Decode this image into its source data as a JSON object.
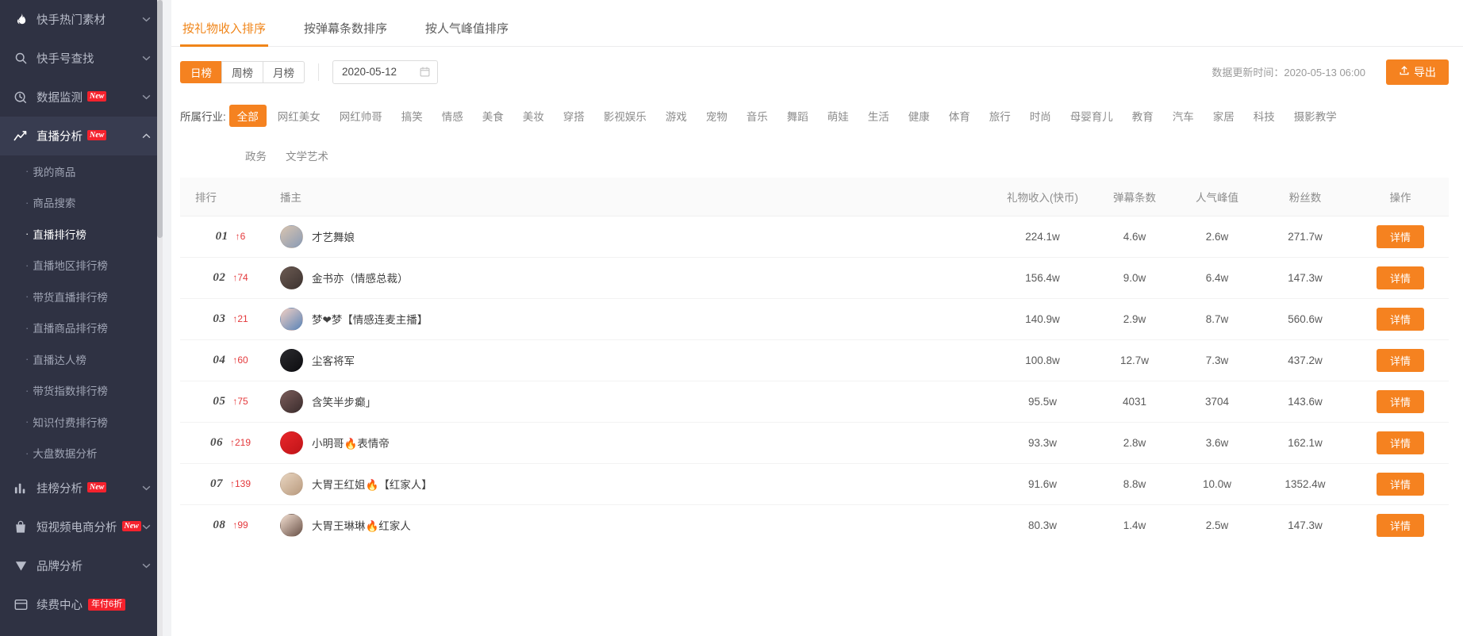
{
  "sidebar": {
    "groups": [
      {
        "id": "hot-material",
        "label": "快手热门素材",
        "icon": "flame-icon",
        "badge": null,
        "expanded": false,
        "active": false
      },
      {
        "id": "account-search",
        "label": "快手号查找",
        "icon": "search-icon",
        "badge": null,
        "expanded": false,
        "active": false
      },
      {
        "id": "data-monitor",
        "label": "数据监测",
        "icon": "monitor-icon",
        "badge": "New",
        "expanded": false,
        "active": false
      },
      {
        "id": "live-analysis",
        "label": "直播分析",
        "icon": "trend-icon",
        "badge": "New",
        "expanded": true,
        "active": true
      }
    ],
    "sub_items": [
      {
        "id": "my-goods",
        "label": "我的商品",
        "current": false
      },
      {
        "id": "goods-search",
        "label": "商品搜索",
        "current": false
      },
      {
        "id": "live-rank",
        "label": "直播排行榜",
        "current": true
      },
      {
        "id": "live-region-rank",
        "label": "直播地区排行榜",
        "current": false
      },
      {
        "id": "goods-live-rank",
        "label": "带货直播排行榜",
        "current": false
      },
      {
        "id": "live-goods-rank",
        "label": "直播商品排行榜",
        "current": false
      },
      {
        "id": "live-talent-rank",
        "label": "直播达人榜",
        "current": false
      },
      {
        "id": "goods-index-rank",
        "label": "带货指数排行榜",
        "current": false
      },
      {
        "id": "knowledge-pay-rank",
        "label": "知识付费排行榜",
        "current": false
      },
      {
        "id": "market-data-analysis",
        "label": "大盘数据分析",
        "current": false
      }
    ],
    "groups_bottom": [
      {
        "id": "board-analysis",
        "label": "挂榜分析",
        "icon": "bars-icon",
        "badge": "New"
      },
      {
        "id": "short-video-ecom",
        "label": "短视频电商分析",
        "icon": "bag-icon",
        "badge": "New"
      },
      {
        "id": "brand-analysis",
        "label": "品牌分析",
        "icon": "shield-icon",
        "badge": null
      },
      {
        "id": "renew-center",
        "label": "续费中心",
        "icon": "card-icon",
        "badge": "年付6折"
      }
    ]
  },
  "tabs": [
    {
      "id": "by-gift-income",
      "label": "按礼物收入排序",
      "selected": true
    },
    {
      "id": "by-danmu-count",
      "label": "按弹幕条数排序",
      "selected": false
    },
    {
      "id": "by-peak-popularity",
      "label": "按人气峰值排序",
      "selected": false
    }
  ],
  "filter": {
    "periods": [
      {
        "id": "daily",
        "label": "日榜",
        "selected": true
      },
      {
        "id": "weekly",
        "label": "周榜",
        "selected": false
      },
      {
        "id": "monthly",
        "label": "月榜",
        "selected": false
      }
    ],
    "date_value": "2020-05-12",
    "updated_text": "数据更新时间：2020-05-13 06:00",
    "export_label": "导出"
  },
  "industry": {
    "label": "所属行业:",
    "chips": [
      {
        "id": "all",
        "label": "全部",
        "selected": true
      },
      {
        "id": "net-beauty",
        "label": "网红美女",
        "selected": false
      },
      {
        "id": "net-handsome",
        "label": "网红帅哥",
        "selected": false
      },
      {
        "id": "funny",
        "label": "搞笑",
        "selected": false
      },
      {
        "id": "emotion",
        "label": "情感",
        "selected": false
      },
      {
        "id": "food",
        "label": "美食",
        "selected": false
      },
      {
        "id": "makeup",
        "label": "美妆",
        "selected": false
      },
      {
        "id": "outfit",
        "label": "穿搭",
        "selected": false
      },
      {
        "id": "film-ent",
        "label": "影视娱乐",
        "selected": false
      },
      {
        "id": "game",
        "label": "游戏",
        "selected": false
      },
      {
        "id": "pet",
        "label": "宠物",
        "selected": false
      },
      {
        "id": "music",
        "label": "音乐",
        "selected": false
      },
      {
        "id": "dance",
        "label": "舞蹈",
        "selected": false
      },
      {
        "id": "cute-baby",
        "label": "萌娃",
        "selected": false
      },
      {
        "id": "life",
        "label": "生活",
        "selected": false
      },
      {
        "id": "health",
        "label": "健康",
        "selected": false
      },
      {
        "id": "sports",
        "label": "体育",
        "selected": false
      },
      {
        "id": "travel",
        "label": "旅行",
        "selected": false
      },
      {
        "id": "fashion",
        "label": "时尚",
        "selected": false
      },
      {
        "id": "parenting",
        "label": "母婴育儿",
        "selected": false
      },
      {
        "id": "education",
        "label": "教育",
        "selected": false
      },
      {
        "id": "auto",
        "label": "汽车",
        "selected": false
      },
      {
        "id": "home",
        "label": "家居",
        "selected": false
      },
      {
        "id": "tech",
        "label": "科技",
        "selected": false
      },
      {
        "id": "photography",
        "label": "摄影教学",
        "selected": false
      },
      {
        "id": "government",
        "label": "政务",
        "selected": false
      },
      {
        "id": "literature-art",
        "label": "文学艺术",
        "selected": false
      }
    ]
  },
  "table": {
    "headers": {
      "rank": "排行",
      "host": "播主",
      "gift_income": "礼物收入(快币)",
      "danmu_count": "弹幕条数",
      "peak_popularity": "人气峰值",
      "fans": "粉丝数",
      "action": "操作"
    },
    "detail_label": "详情",
    "rows": [
      {
        "rank": "01",
        "change": "↑6",
        "name": "才艺舞娘",
        "gift_income": "224.1w",
        "danmu": "4.6w",
        "peak": "2.6w",
        "fans": "271.7w",
        "c1": "#d8c4b0",
        "c2": "#8a9bb5"
      },
      {
        "rank": "02",
        "change": "↑74",
        "name": "金书亦（情感总裁）",
        "gift_income": "156.4w",
        "danmu": "9.0w",
        "peak": "6.4w",
        "fans": "147.3w",
        "c1": "#6b5a52",
        "c2": "#3d3330"
      },
      {
        "rank": "03",
        "change": "↑21",
        "name": "梦❤梦【情感连麦主播】",
        "gift_income": "140.9w",
        "danmu": "2.9w",
        "peak": "8.7w",
        "fans": "560.6w",
        "c1": "#f0cfc4",
        "c2": "#5a84b8"
      },
      {
        "rank": "04",
        "change": "↑60",
        "name": "尘客将军",
        "gift_income": "100.8w",
        "danmu": "12.7w",
        "peak": "7.3w",
        "fans": "437.2w",
        "c1": "#2a2a2e",
        "c2": "#0d0d10"
      },
      {
        "rank": "05",
        "change": "↑75",
        "name": "含笑半步癫」",
        "gift_income": "95.5w",
        "danmu": "4031",
        "peak": "3704",
        "fans": "143.6w",
        "c1": "#7a5c5a",
        "c2": "#3a2c2c"
      },
      {
        "rank": "06",
        "change": "↑219",
        "name": "小明哥🔥表情帝",
        "gift_income": "93.3w",
        "danmu": "2.8w",
        "peak": "3.6w",
        "fans": "162.1w",
        "c1": "#e8262a",
        "c2": "#c01418"
      },
      {
        "rank": "07",
        "change": "↑139",
        "name": "大胃王红姐🔥【红家人】",
        "gift_income": "91.6w",
        "danmu": "8.8w",
        "peak": "10.0w",
        "fans": "1352.4w",
        "c1": "#e8d5c0",
        "c2": "#b99a7e"
      },
      {
        "rank": "08",
        "change": "↑99",
        "name": "大胃王琳琳🔥红家人",
        "gift_income": "80.3w",
        "danmu": "1.4w",
        "peak": "2.5w",
        "fans": "147.3w",
        "c1": "#f2ded0",
        "c2": "#6a5248"
      }
    ]
  }
}
